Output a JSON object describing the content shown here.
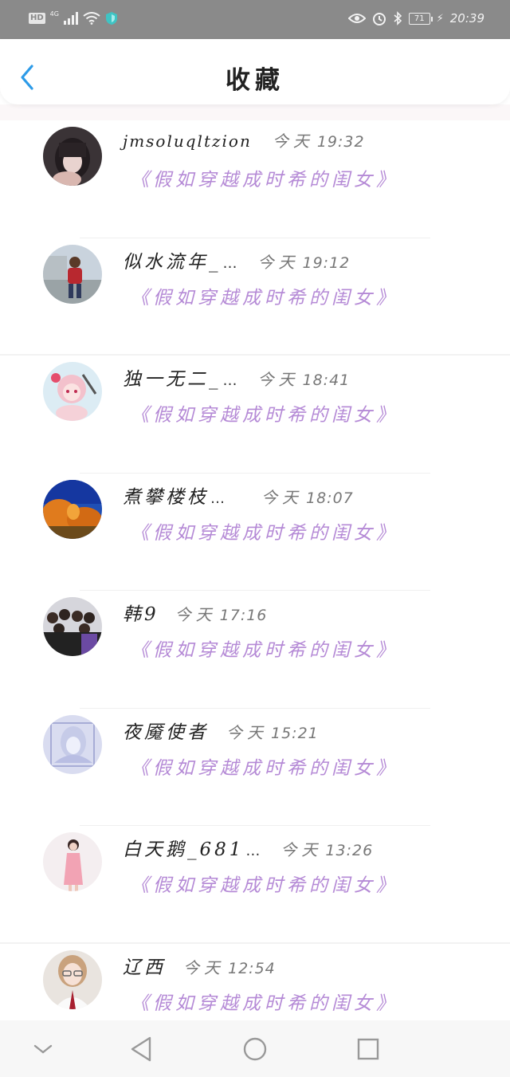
{
  "status_bar": {
    "hd": "HD",
    "network": "4G",
    "battery": "71",
    "time": "20:39"
  },
  "header": {
    "title": "收藏"
  },
  "items": [
    {
      "nickname": "jmsoluqltzion",
      "truncated": false,
      "latin": true,
      "day": "今天",
      "time": "19:32",
      "book": "《假如穿越成时希的闺女》"
    },
    {
      "nickname": "似水流年_",
      "truncated": true,
      "latin": false,
      "day": "今天",
      "time": "19:12",
      "book": "《假如穿越成时希的闺女》"
    },
    {
      "nickname": "独一无二_",
      "truncated": true,
      "latin": false,
      "day": "今天",
      "time": "18:41",
      "book": "《假如穿越成时希的闺女》"
    },
    {
      "nickname": "煮攀楼枝",
      "truncated": true,
      "latin": false,
      "day": "今天",
      "time": "18:07",
      "book": "《假如穿越成时希的闺女》"
    },
    {
      "nickname": "韩9",
      "truncated": false,
      "latin": false,
      "day": "今天",
      "time": "17:16",
      "book": "《假如穿越成时希的闺女》"
    },
    {
      "nickname": "夜魇使者",
      "truncated": false,
      "latin": false,
      "day": "今天",
      "time": "15:21",
      "book": "《假如穿越成时希的闺女》"
    },
    {
      "nickname": "白天鹅_681",
      "truncated": true,
      "latin": false,
      "day": "今天",
      "time": "13:26",
      "book": "《假如穿越成时希的闺女》"
    },
    {
      "nickname": "辽西",
      "truncated": false,
      "latin": false,
      "day": "今天",
      "time": "12:54",
      "book": "《假如穿越成时希的闺女》"
    }
  ],
  "colors": {
    "accent_back": "#2d9be8",
    "book_link": "#b58ad6",
    "status_bar": "#8a8a8a"
  },
  "icons": {
    "back": "chevron-left-icon",
    "nav_collapse": "chevron-down-icon",
    "nav_back": "triangle-back-icon",
    "nav_home": "circle-home-icon",
    "nav_recent": "square-recent-icon"
  }
}
